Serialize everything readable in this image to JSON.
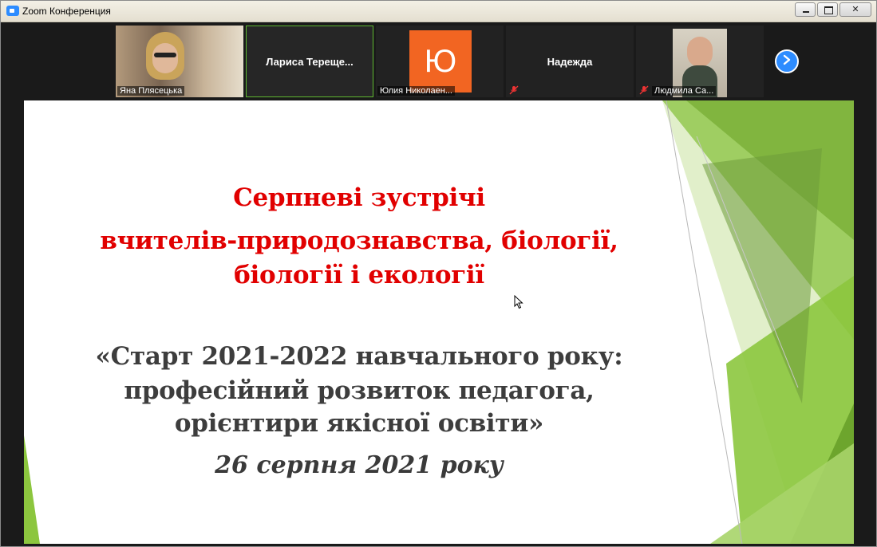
{
  "window": {
    "title": "Zoom Конференция",
    "controls": {
      "minimize": "–",
      "maximize": "□",
      "close": "✕"
    }
  },
  "participants": [
    {
      "name": "Яна Плясецька",
      "type": "video"
    },
    {
      "name": "Лариса  Терещенко",
      "display": "Лариса  Терещe...",
      "type": "name",
      "active": true
    },
    {
      "name": "Юлия Николаен...",
      "type": "avatar",
      "initial": "Ю"
    },
    {
      "name": "Надежда",
      "type": "name",
      "muted": true
    },
    {
      "name": "Людмила Са...",
      "type": "video",
      "muted": true
    }
  ],
  "next_page_icon": "chevron-right-icon",
  "slide": {
    "heading_lines": [
      "Серпневі зустрічі",
      "вчителів-природознавства, біології,",
      "біології і екології"
    ],
    "subtitle_lines": [
      "«Старт 2021-2022 навчального року:",
      "професійний розвиток педагога,",
      "орієнтири якісної освіти»"
    ],
    "date": "26 серпня 2021 року"
  },
  "colors": {
    "heading": "#e10000",
    "body_text": "#3d3d3d",
    "accent_green": "#8cc63e",
    "avatar_orange": "#f26522",
    "zoom_blue": "#2d8cff"
  }
}
